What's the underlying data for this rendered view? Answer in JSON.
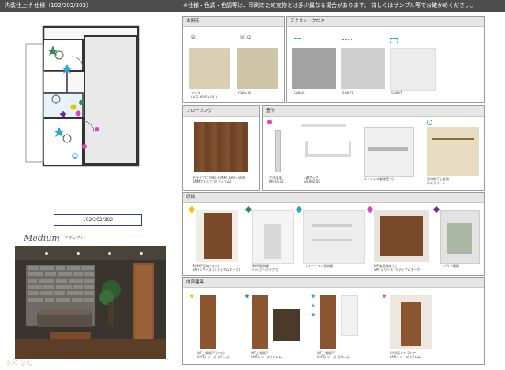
{
  "header": {
    "title": "内装仕上げ 仕様（102/202/302）",
    "notice": "※仕様・色調・色調等は、印刷のため実物とは多少異なる場合があります。 詳しくはサンプル等でお確かめください。"
  },
  "plan_label": "102/202/302",
  "medium": {
    "title": "Medium",
    "sub": "ミディアム"
  },
  "logo": {
    "text": "ふくなむ"
  },
  "panels": {
    "genkan": {
      "title": "玄関床",
      "col_labels": [
        "S01",
        "S01-02"
      ],
      "captions": [
        "アレス\n(ALS-3005+S01)",
        "GMO-14"
      ]
    },
    "accent": {
      "title": "アクセントクロス",
      "captions": [
        "SAN60",
        "SAN23",
        "SAN47"
      ]
    },
    "flooring": {
      "title": "フローリング",
      "caption": "ドライフロア床 (天然木) GAH-3006\nBNMフォルフ (ミディアム)"
    },
    "accessories": {
      "title": "造作",
      "captions": [
        "タオル掛\nKH-31-12",
        "3連フック\nAS-602-SC",
        "ステンレス製棚受 (小)",
        "室内物干し金物\nホスクリーン"
      ]
    },
    "storage": {
      "title": "収納",
      "captions": [
        "SHM下足箱 (ラン)\nSMTシリーズ (ミディアムチーク)",
        "SHM収納棚\nハンガーパイプ付",
        "ウォークイン収納棚",
        "WF扉収納扉 (上\nSMTシリーズ (ミディアムチーク)",
        "パイプ棚板"
      ]
    },
    "doors": {
      "title": "内部建具",
      "captions": [
        "WF上質開戸 (ドロ)\nSMTシリーズ (ブレム)",
        "WF上質開戸\nSMTシリーズ (ブレム)",
        "WF上質開戸\nSMTシリーズ (ブレム)",
        "SHM両ドア 3ドア\nSMTシリーズ (ブレム)"
      ]
    }
  },
  "colors": {
    "header_bg": "#4d4d4d",
    "wood": "#7a4a2b",
    "beige": "#d8cbb2",
    "gray_cloth": "#a3a3a3",
    "light_gray_cloth": "#cfcfcf",
    "white_cloth": "#ececec",
    "yellow_marker": "#f2c200",
    "green_marker": "#2e8b57",
    "blue_marker": "#29a3e0",
    "pink_marker": "#e040c8",
    "purple_marker": "#6a2aa8"
  }
}
